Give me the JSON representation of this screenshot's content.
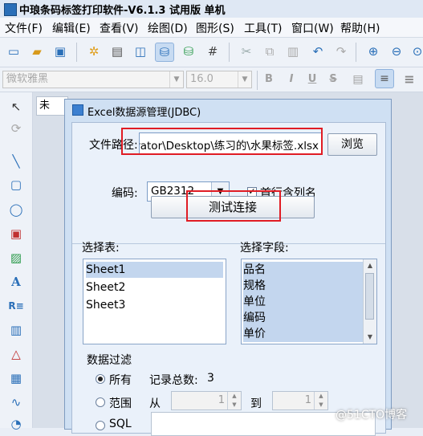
{
  "app": {
    "title": "中琅条码标签打印软件-V6.1.3 试用版 单机"
  },
  "menu": [
    "文件(F)",
    "编辑(E)",
    "查看(V)",
    "绘图(D)",
    "图形(S)",
    "工具(T)",
    "窗口(W)",
    "帮助(H)"
  ],
  "fontbar": {
    "font_name": "微软雅黑",
    "font_size": "16.0",
    "bold": "B",
    "italic": "I",
    "underline": "U",
    "strike": "S"
  },
  "doc_tab": {
    "label": "未"
  },
  "dialog": {
    "title": "Excel数据源管理(JDBC)",
    "file_path_label": "文件路径:",
    "file_path_value": "rator\\Desktop\\练习的\\水果标签.xlsx",
    "browse_label": "浏览",
    "encoding_label": "编码:",
    "encoding_value": "GB2312",
    "header_checkbox_label": "首行含列名",
    "test_button_label": "测试连接",
    "tables_label": "选择表:",
    "fields_label": "选择字段:",
    "tables": [
      "Sheet1",
      "Sheet2",
      "Sheet3"
    ],
    "fields": [
      "品名",
      "规格",
      "单位",
      "编码",
      "单价"
    ],
    "filter_label": "数据过滤",
    "radio_all": "所有",
    "record_total_label": "记录总数:",
    "record_total": "3",
    "radio_range": "范围",
    "from_label": "从",
    "from_value": "1",
    "to_label": "到",
    "to_value": "1",
    "radio_sql": "SQL"
  },
  "watermark": "@51CTO博客",
  "colors": {
    "highlight_box": "#e01c24",
    "selection": "#c3d6ee",
    "accent": "#2a6fb8"
  }
}
